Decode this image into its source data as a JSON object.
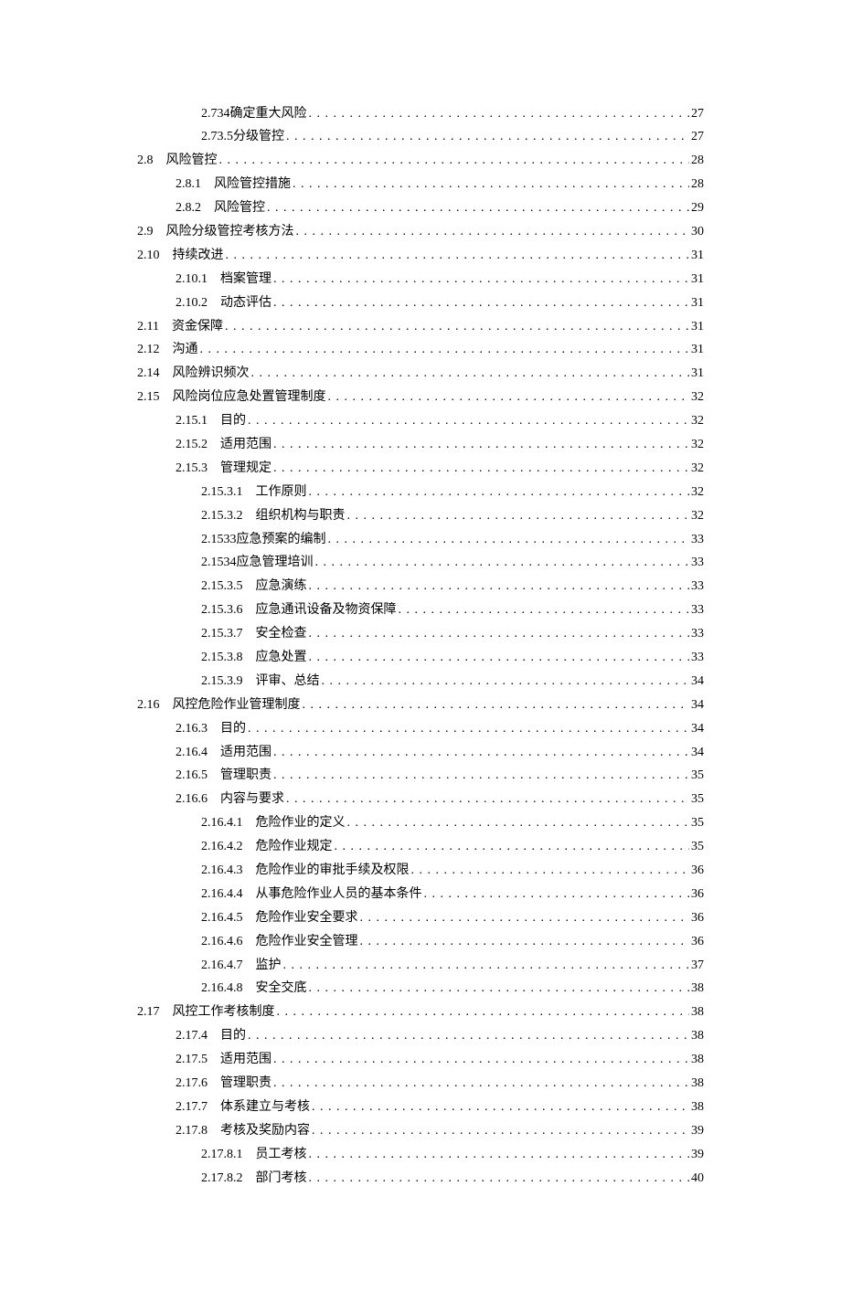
{
  "toc": [
    {
      "level": 3,
      "num": "2.734",
      "gap": " ",
      "title": "确定重大风险",
      "trail": " ",
      "page": "27"
    },
    {
      "level": 3,
      "num": "2.73.5",
      "gap": " ",
      "title": "分级管控",
      "trail": "",
      "page": "27"
    },
    {
      "level": 1,
      "num": "2.8",
      "gap": "　",
      "title": "风险管控",
      "trail": "",
      "page": "28"
    },
    {
      "level": 2,
      "num": "2.8.1",
      "gap": "　",
      "title": "风险管控措施",
      "trail": "",
      "page": "28"
    },
    {
      "level": 2,
      "num": "2.8.2",
      "gap": "　",
      "title": "风险管控",
      "trail": "",
      "page": "29"
    },
    {
      "level": 1,
      "num": "2.9",
      "gap": "　",
      "title": "风险分级管控考核方法",
      "trail": "",
      "page": "30"
    },
    {
      "level": 1,
      "num": "2.10",
      "gap": "　",
      "title": "持续改进",
      "trail": "",
      "page": "31"
    },
    {
      "level": 2,
      "num": "2.10.1",
      "gap": "　",
      "title": "档案管理",
      "trail": "",
      "page": "31"
    },
    {
      "level": 2,
      "num": "2.10.2",
      "gap": "　",
      "title": "动态评估",
      "trail": "",
      "page": "31"
    },
    {
      "level": 1,
      "num": "2.11",
      "gap": "　",
      "title": "资金保障",
      "trail": "",
      "page": "31"
    },
    {
      "level": 1,
      "num": "2.12",
      "gap": "　",
      "title": "沟通",
      "trail": "",
      "page": "31"
    },
    {
      "level": 1,
      "num": "2.14",
      "gap": "　",
      "title": "风险辨识频次",
      "trail": "",
      "page": "31"
    },
    {
      "level": 1,
      "num": "2.15",
      "gap": "　",
      "title": "风险岗位应急处置管理制度",
      "trail": "",
      "page": "32"
    },
    {
      "level": 2,
      "num": "2.15.1",
      "gap": "　",
      "title": "目的",
      "trail": "",
      "page": "32"
    },
    {
      "level": 2,
      "num": "2.15.2",
      "gap": "　",
      "title": "适用范围",
      "trail": "",
      "page": "32"
    },
    {
      "level": 2,
      "num": "2.15.3",
      "gap": "　",
      "title": "管理规定",
      "trail": "",
      "page": "32"
    },
    {
      "level": 3,
      "num": "2.15.3.1",
      "gap": "　",
      "title": "工作原则",
      "trail": "",
      "page": "32"
    },
    {
      "level": 3,
      "num": "2.15.3.2",
      "gap": "　",
      "title": "组织机构与职责",
      "trail": "",
      "page": "32"
    },
    {
      "level": 3,
      "num": "2.1533",
      "gap": " ",
      "title": "应急预案的编制",
      "trail": " ",
      "page": "33"
    },
    {
      "level": 3,
      "num": "2.1534",
      "gap": " ",
      "title": "应急管理培训",
      "trail": " ",
      "page": "33"
    },
    {
      "level": 3,
      "num": "2.15.3.5",
      "gap": "　",
      "title": "应急演练",
      "trail": "",
      "page": "33"
    },
    {
      "level": 3,
      "num": "2.15.3.6",
      "gap": "　",
      "title": "应急通讯设备及物资保障",
      "trail": "",
      "page": "33"
    },
    {
      "level": 3,
      "num": "2.15.3.7",
      "gap": "　",
      "title": "安全检查",
      "trail": "",
      "page": "33"
    },
    {
      "level": 3,
      "num": "2.15.3.8",
      "gap": "　",
      "title": "应急处置",
      "trail": "",
      "page": "33"
    },
    {
      "level": 3,
      "num": "2.15.3.9",
      "gap": "　",
      "title": "评审、总结",
      "trail": "",
      "page": "34"
    },
    {
      "level": 1,
      "num": "2.16",
      "gap": "　",
      "title": "风控危险作业管理制度",
      "trail": "",
      "page": "34"
    },
    {
      "level": 2,
      "num": "2.16.3",
      "gap": "　",
      "title": "目的",
      "trail": "",
      "page": "34"
    },
    {
      "level": 2,
      "num": "2.16.4",
      "gap": "　",
      "title": "适用范围",
      "trail": "",
      "page": "34"
    },
    {
      "level": 2,
      "num": "2.16.5",
      "gap": "　",
      "title": "管理职责",
      "trail": "",
      "page": "35"
    },
    {
      "level": 2,
      "num": "2.16.6",
      "gap": "　",
      "title": "内容与要求",
      "trail": "",
      "page": "35"
    },
    {
      "level": 3,
      "num": "2.16.4.1",
      "gap": "　",
      "title": "危险作业的定义",
      "trail": "",
      "page": "35"
    },
    {
      "level": 3,
      "num": "2.16.4.2",
      "gap": "　",
      "title": "危险作业规定",
      "trail": "",
      "page": "35"
    },
    {
      "level": 3,
      "num": "2.16.4.3",
      "gap": "　",
      "title": "危险作业的审批手续及权限",
      "trail": "",
      "page": "36"
    },
    {
      "level": 3,
      "num": "2.16.4.4",
      "gap": "　",
      "title": "从事危险作业人员的基本条件",
      "trail": "",
      "page": "36"
    },
    {
      "level": 3,
      "num": "2.16.4.5",
      "gap": "　",
      "title": "危险作业安全要求",
      "trail": "",
      "page": "36"
    },
    {
      "level": 3,
      "num": "2.16.4.6",
      "gap": "　",
      "title": "危险作业安全管理",
      "trail": "",
      "page": "36"
    },
    {
      "level": 3,
      "num": "2.16.4.7",
      "gap": "　",
      "title": "监护",
      "trail": "",
      "page": "37"
    },
    {
      "level": 3,
      "num": "2.16.4.8",
      "gap": "　",
      "title": "安全交底",
      "trail": "",
      "page": "38"
    },
    {
      "level": 1,
      "num": "2.17",
      "gap": "　",
      "title": "风控工作考核制度",
      "trail": "",
      "page": "38"
    },
    {
      "level": 2,
      "num": "2.17.4",
      "gap": "　",
      "title": "目的",
      "trail": "",
      "page": "38"
    },
    {
      "level": 2,
      "num": "2.17.5",
      "gap": "　",
      "title": "适用范围",
      "trail": "",
      "page": "38"
    },
    {
      "level": 2,
      "num": "2.17.6",
      "gap": "　",
      "title": "管理职责",
      "trail": "",
      "page": "38"
    },
    {
      "level": 2,
      "num": "2.17.7",
      "gap": "　",
      "title": "体系建立与考核",
      "trail": "",
      "page": "38"
    },
    {
      "level": 2,
      "num": "2.17.8",
      "gap": "　",
      "title": "考核及奖励内容",
      "trail": "",
      "page": "39"
    },
    {
      "level": 3,
      "num": "2.17.8.1",
      "gap": "　",
      "title": "员工考核",
      "trail": "",
      "page": "39"
    },
    {
      "level": 3,
      "num": "2.17.8.2",
      "gap": "　",
      "title": "部门考核",
      "trail": "",
      "page": "40"
    }
  ]
}
